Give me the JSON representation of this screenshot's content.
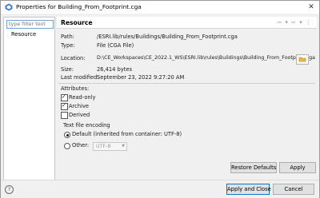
{
  "window": {
    "title": "Properties for Building_From_Footprint.cga",
    "close_glyph": "✕"
  },
  "left": {
    "filter_placeholder": "type filter text",
    "items": [
      {
        "label": "Resource"
      }
    ]
  },
  "header": {
    "title": "Resource"
  },
  "info": {
    "path_label": "Path:",
    "path_value": "/ESRI.lib/rules/Buildings/Building_From_Footprint.cga",
    "type_label": "Type:",
    "type_value": "File  (CGA File)",
    "location_label": "Location:",
    "location_value": "D:\\CE_Workspaces\\CE_2022.1_WS\\ESRI.lib\\rules\\Buildings\\Building_From_Footprint.cga",
    "size_label": "Size:",
    "size_value": "26,414  bytes",
    "modified_label": "Last modified:",
    "modified_value": "September 23, 2022 9:27:20 AM"
  },
  "attributes": {
    "title": "Attributes:",
    "items": [
      {
        "label": "Read-only",
        "checked": true
      },
      {
        "label": "Archive",
        "checked": true
      },
      {
        "label": "Derived",
        "checked": false
      }
    ]
  },
  "encoding": {
    "title": "Text file encoding",
    "default_label": "Default (inherited from container: UTF-8)",
    "other_label": "Other:",
    "other_value": "UTF-8",
    "selected": "default"
  },
  "buttons": {
    "restore_defaults": "Restore Defaults",
    "apply": "Apply",
    "apply_and_close": "Apply and Close",
    "cancel": "Cancel"
  }
}
